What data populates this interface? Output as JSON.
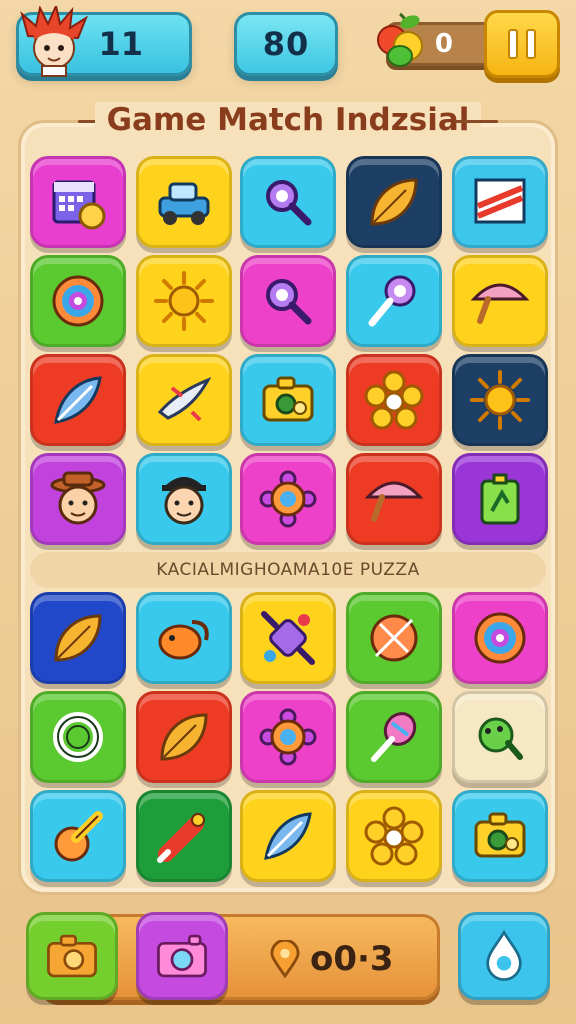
{
  "header": {
    "level": "11",
    "score": "80",
    "fruit_count": "0",
    "avatar_icon": "spiky-hair-avatar-icon",
    "fruit_icon": "fruit-icon",
    "pause_icon": "pause-icon"
  },
  "title": "Game Match Indzsial",
  "divider_text": "KACIALMIGHOAMA10E PUZZA",
  "grid_top": [
    {
      "icon": "calendar-icon",
      "color": "#e83fd0"
    },
    {
      "icon": "car-icon",
      "color": "#ffd21c"
    },
    {
      "icon": "magnifier-icon",
      "color": "#38c9ec"
    },
    {
      "icon": "leaf-icon",
      "color": "#1d3f66"
    },
    {
      "icon": "picture-icon",
      "color": "#3cc6ec"
    },
    {
      "icon": "swirl-icon",
      "color": "#5bc930"
    },
    {
      "icon": "sun-icon",
      "color": "#ffd21c"
    },
    {
      "icon": "magnifier-icon",
      "color": "#ee41c9"
    },
    {
      "icon": "lollipop-icon",
      "color": "#38c9ec"
    },
    {
      "icon": "umbrella-icon",
      "color": "#ffd21c"
    },
    {
      "icon": "feather-icon",
      "color": "#ee3b24"
    },
    {
      "icon": "bird-icon",
      "color": "#ffd21c"
    },
    {
      "icon": "camera-icon",
      "color": "#38c9ec"
    },
    {
      "icon": "flower-icon",
      "color": "#ee3b24"
    },
    {
      "icon": "sun-icon",
      "color": "#1d3f66"
    },
    {
      "icon": "cowboy-face-icon",
      "color": "#c142dd"
    },
    {
      "icon": "face-icon",
      "color": "#38c9ec"
    },
    {
      "icon": "gear-flower-icon",
      "color": "#ee41c9"
    },
    {
      "icon": "umbrella-icon",
      "color": "#ee3b24"
    },
    {
      "icon": "battery-icon",
      "color": "#9a35d8"
    }
  ],
  "grid_bottom": [
    {
      "icon": "leaf-icon",
      "color": "#2048c9"
    },
    {
      "icon": "fish-icon",
      "color": "#38c9ec"
    },
    {
      "icon": "candy-icon",
      "color": "#ffd21c"
    },
    {
      "icon": "ball-icon",
      "color": "#5bc930"
    },
    {
      "icon": "swirl-icon",
      "color": "#ee41c9"
    },
    {
      "icon": "ring-icon",
      "color": "#5bc930"
    },
    {
      "icon": "leaf-icon",
      "color": "#ee3b24"
    },
    {
      "icon": "gear-flower-icon",
      "color": "#ee41c9"
    },
    {
      "icon": "ice-cream-icon",
      "color": "#5bc930"
    },
    {
      "icon": "frog-icon",
      "color": "#f6e8c4"
    },
    {
      "icon": "pencil-icon",
      "color": "#38c9ec"
    },
    {
      "icon": "marker-icon",
      "color": "#1e9e3a"
    },
    {
      "icon": "feather-icon",
      "color": "#ffd21c"
    },
    {
      "icon": "flower-icon",
      "color": "#ffd21c"
    },
    {
      "icon": "camera-icon",
      "color": "#38c9ec"
    }
  ],
  "bottom": {
    "btn1_icon": "camera-icon",
    "btn2_icon": "camera-icon",
    "counter_icon": "map-pin-icon",
    "counter_value": "o0·3",
    "btn3_icon": "water-drop-icon"
  }
}
